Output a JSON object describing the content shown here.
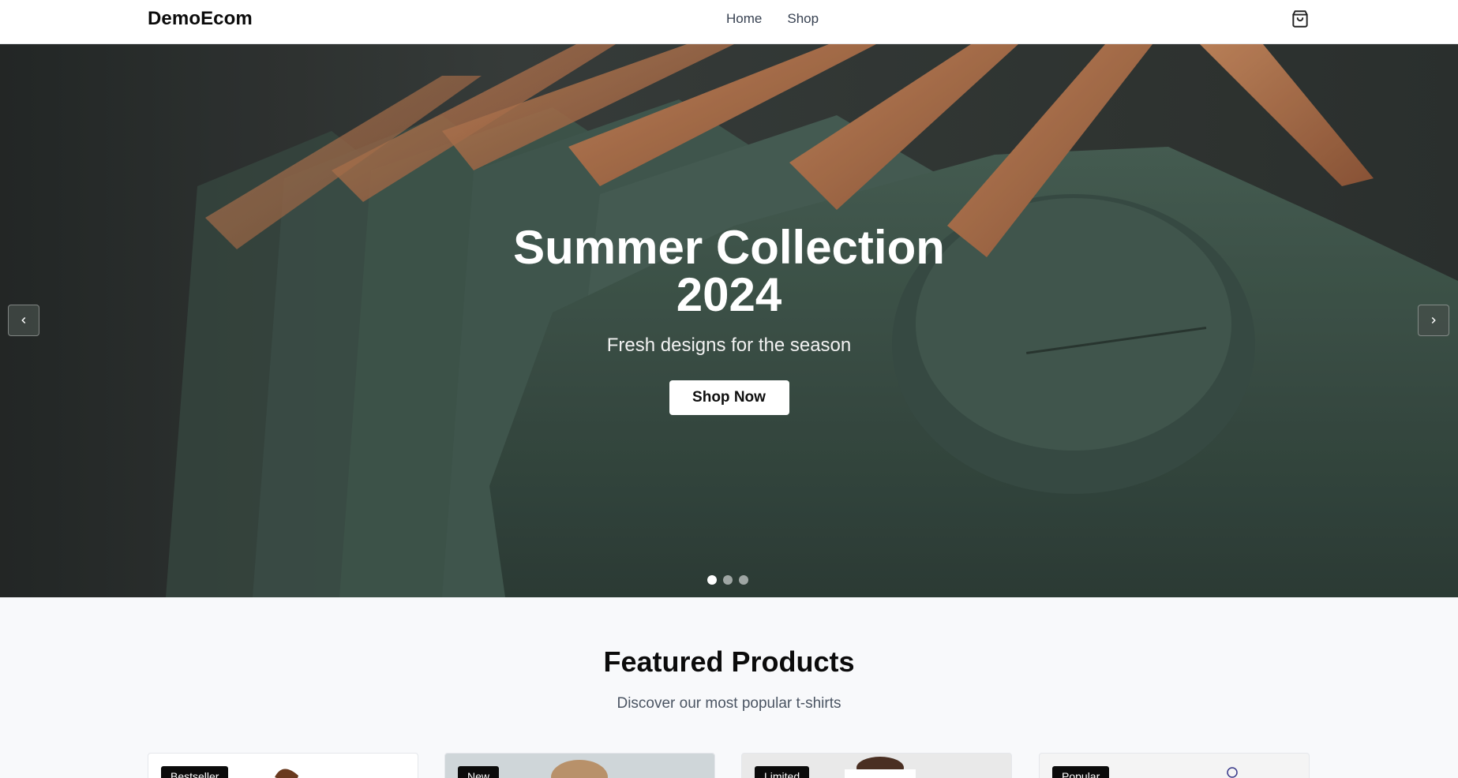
{
  "header": {
    "brand": "DemoEcom",
    "nav": [
      "Home",
      "Shop"
    ],
    "cart_icon": "shopping-bag-icon"
  },
  "hero": {
    "title": "Summer Collection 2024",
    "subtitle": "Fresh designs for the season",
    "cta_label": "Shop Now",
    "prev_icon": "chevron-left-icon",
    "next_icon": "chevron-right-icon",
    "slides_count": 3,
    "active_slide": 1
  },
  "featured": {
    "title": "Featured Products",
    "subtitle": "Discover our most popular t-shirts",
    "products": [
      {
        "badge": "Bestseller",
        "color": "#ffffff"
      },
      {
        "badge": "New",
        "color": "#cfd6d9"
      },
      {
        "badge": "Limited",
        "color": "#e9e9e9"
      },
      {
        "badge": "Popular",
        "color": "#f4f4f4"
      }
    ]
  },
  "colors": {
    "header_bg": "#ffffff",
    "hero_shirt": "#3e554b",
    "hanger_wood": "#b06f45",
    "page_bg": "#f8f9fb",
    "badge_bg": "#0b0b0b"
  }
}
